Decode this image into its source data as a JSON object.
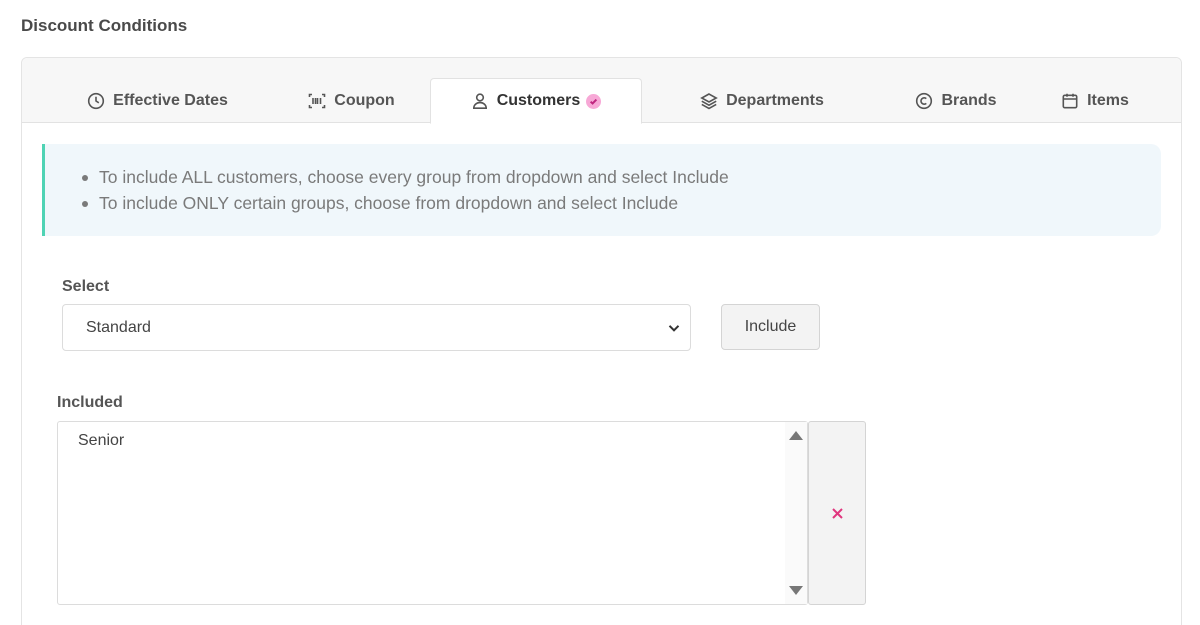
{
  "section_title": "Discount Conditions",
  "tabs": [
    {
      "label": "Effective Dates",
      "icon": "clock-icon"
    },
    {
      "label": "Coupon",
      "icon": "barcode-icon"
    },
    {
      "label": "Customers",
      "icon": "user-icon",
      "active": true,
      "badge": "check-badge-icon"
    },
    {
      "label": "Departments",
      "icon": "layers-icon"
    },
    {
      "label": "Brands",
      "icon": "copyright-icon"
    },
    {
      "label": "Items",
      "icon": "calendar-icon"
    }
  ],
  "info": {
    "lines": [
      "To include ALL customers, choose every group from dropdown and select Include",
      "To include ONLY certain groups, choose from dropdown and select Include"
    ]
  },
  "select": {
    "label": "Select",
    "value": "Standard"
  },
  "include_button": "Include",
  "included": {
    "label": "Included",
    "items": [
      "Senior"
    ]
  },
  "colors": {
    "accent_border": "#4fd3b4",
    "info_bg": "#f0f7fb",
    "badge": "#f7a8d6",
    "remove": "#e0367e"
  }
}
